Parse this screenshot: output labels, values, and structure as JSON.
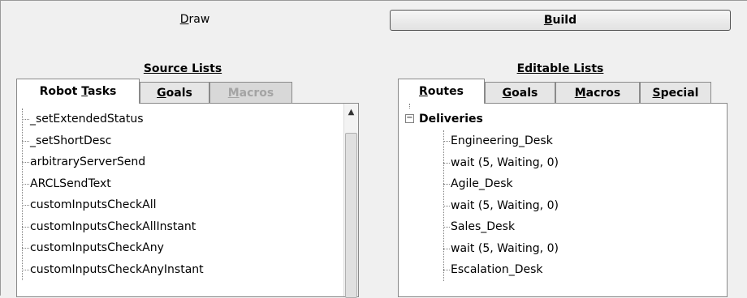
{
  "top_buttons": {
    "draw": {
      "pre": "",
      "key": "D",
      "post": "raw"
    },
    "build": {
      "pre": "",
      "key": "B",
      "post": "uild"
    }
  },
  "source_section": {
    "caption": "Source Lists",
    "tabs": [
      {
        "pre": "Robot ",
        "key": "T",
        "post": "asks"
      },
      {
        "pre": "",
        "key": "G",
        "post": "oals"
      },
      {
        "pre": "",
        "key": "M",
        "post": "acros"
      }
    ],
    "items": [
      "_setExtendedStatus",
      "_setShortDesc",
      "arbitraryServerSend",
      "ARCLSendText",
      "customInputsCheckAll",
      "customInputsCheckAllInstant",
      "customInputsCheckAny",
      "customInputsCheckAnyInstant"
    ]
  },
  "editable_section": {
    "caption": "Editable Lists",
    "tabs": [
      {
        "pre": "",
        "key": "R",
        "post": "outes"
      },
      {
        "pre": "",
        "key": "G",
        "post": "oals"
      },
      {
        "pre": "",
        "key": "M",
        "post": "acros"
      },
      {
        "pre": "",
        "key": "S",
        "post": "pecial"
      }
    ],
    "tree": {
      "root": "Deliveries",
      "expander": "−",
      "children": [
        "Engineering_Desk",
        "wait (5, Waiting, 0)",
        "Agile_Desk",
        "wait (5, Waiting, 0)",
        "Sales_Desk",
        "wait (5, Waiting, 0)",
        "Escalation_Desk"
      ]
    }
  },
  "scrollbar": {
    "up_arrow": "▲"
  }
}
